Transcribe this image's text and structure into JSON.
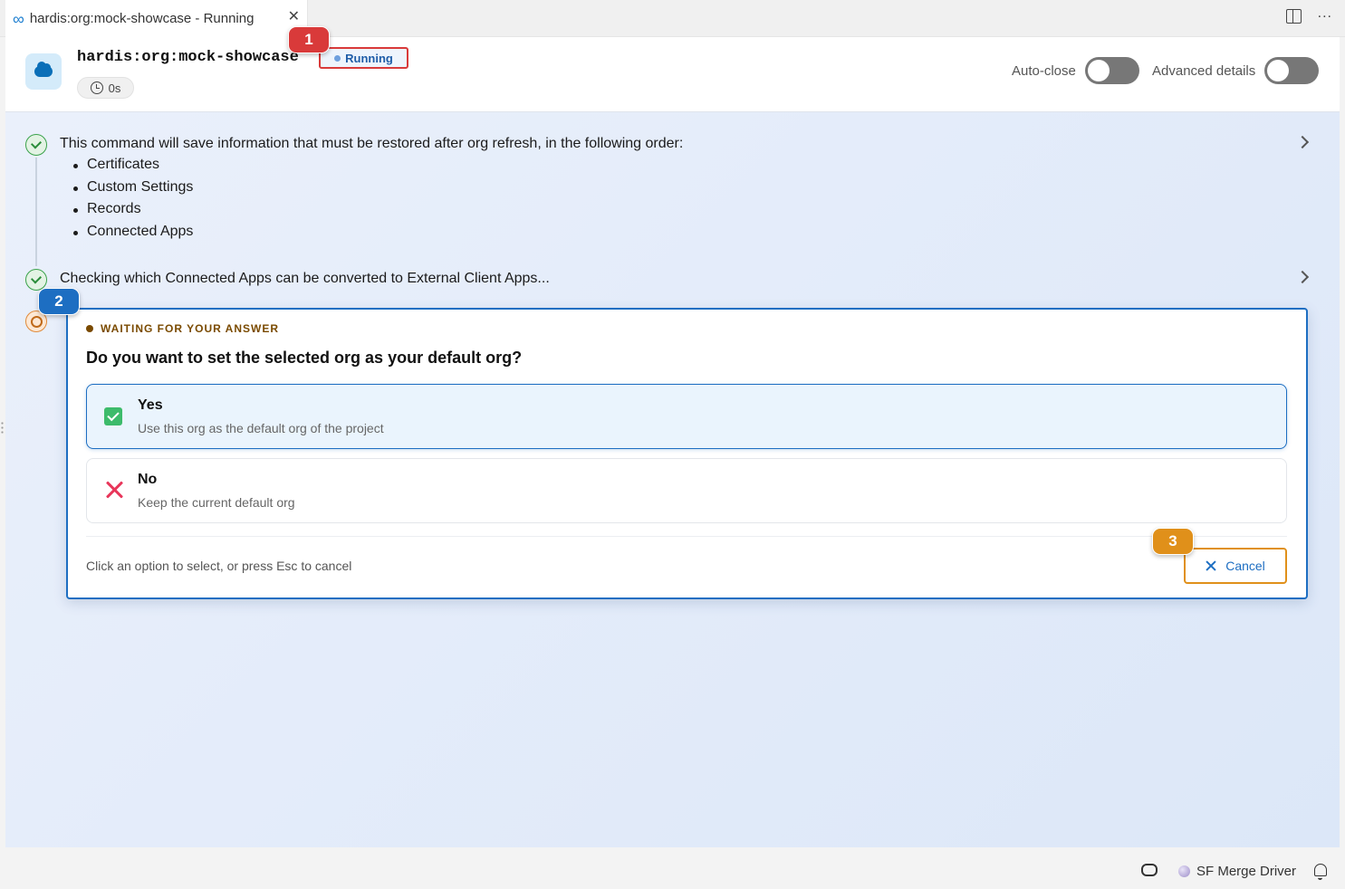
{
  "tab": {
    "title": "hardis:org:mock-showcase - Running",
    "icon": "infinity-icon"
  },
  "header": {
    "command": "hardis:org:mock-showcase",
    "status": "Running",
    "elapsed": "0s",
    "auto_close_label": "Auto-close",
    "advanced_details_label": "Advanced details"
  },
  "steps": [
    {
      "text": "This command will save information that must be restored after org refresh, in the following order:",
      "items": [
        "Certificates",
        "Custom Settings",
        "Records",
        "Connected Apps"
      ],
      "status": "done"
    },
    {
      "text": "Checking which Connected Apps can be converted to External Client Apps...",
      "status": "done"
    }
  ],
  "prompt": {
    "waiting_label": "WAITING FOR YOUR ANSWER",
    "question": "Do you want to set the selected org as your default org?",
    "options": [
      {
        "title": "Yes",
        "description": "Use this org as the default org of the project",
        "selected": true
      },
      {
        "title": "No",
        "description": "Keep the current default org",
        "selected": false
      }
    ],
    "hint": "Click an option to select, or press Esc to cancel",
    "cancel_label": "Cancel"
  },
  "callouts": [
    "1",
    "2",
    "3"
  ],
  "statusbar": {
    "merge_driver": "SF Merge Driver"
  },
  "colors": {
    "accent": "#1d6ec2",
    "running": "#d93a3a",
    "warning": "#e0901a",
    "success": "#3dbb6b",
    "danger": "#e8365a"
  }
}
